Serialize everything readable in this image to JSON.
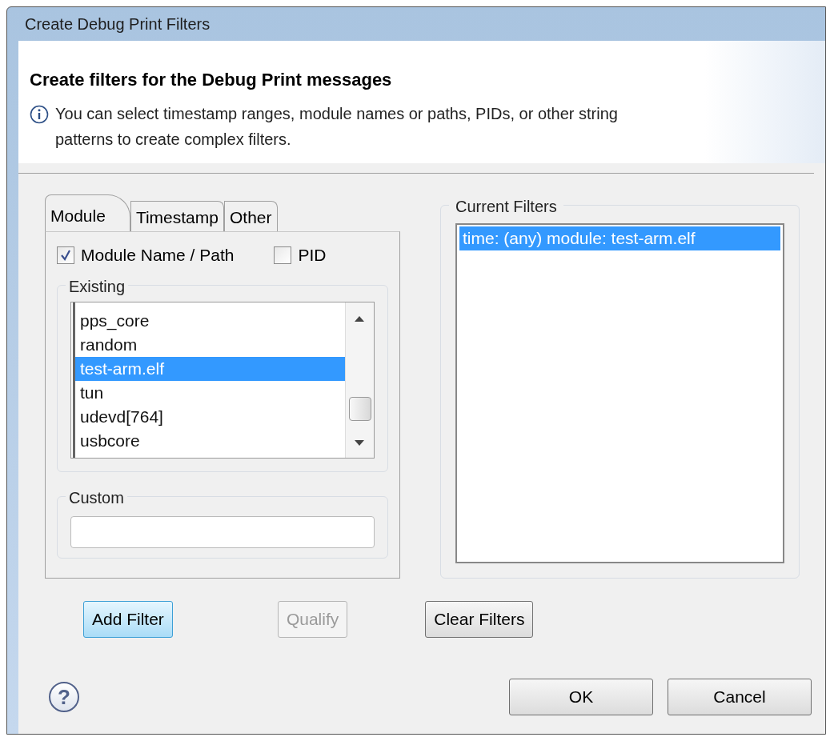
{
  "window": {
    "title": "Create Debug Print Filters"
  },
  "header": {
    "title": "Create filters for the Debug Print messages",
    "message": "You can select timestamp ranges, module names or paths, PIDs, or other string patterns to create complex filters."
  },
  "tabs": [
    {
      "label": "Module",
      "selected": true
    },
    {
      "label": "Timestamp",
      "selected": false
    },
    {
      "label": "Other",
      "selected": false
    }
  ],
  "checkboxes": [
    {
      "label": "Module Name / Path",
      "checked": true
    },
    {
      "label": "PID",
      "checked": false
    }
  ],
  "existing": {
    "title": "Existing",
    "items": [
      {
        "label": "pps_core",
        "selected": false
      },
      {
        "label": "random",
        "selected": false
      },
      {
        "label": "test-arm.elf",
        "selected": true
      },
      {
        "label": "tun",
        "selected": false
      },
      {
        "label": "udevd[764]",
        "selected": false
      },
      {
        "label": "usbcore",
        "selected": false
      }
    ]
  },
  "custom": {
    "title": "Custom"
  },
  "current_filters": {
    "title": "Current Filters",
    "items": [
      {
        "label": "time: (any) module: test-arm.elf",
        "selected": true
      }
    ]
  },
  "action_buttons": [
    {
      "label": "Add Filter",
      "kind": "default",
      "disabled": false
    },
    {
      "label": "Qualify",
      "kind": "normal",
      "disabled": true
    },
    {
      "label": "Clear Filters",
      "kind": "normal",
      "disabled": false
    }
  ],
  "help_button": "?",
  "dialog_buttons": [
    "OK",
    "Cancel"
  ]
}
